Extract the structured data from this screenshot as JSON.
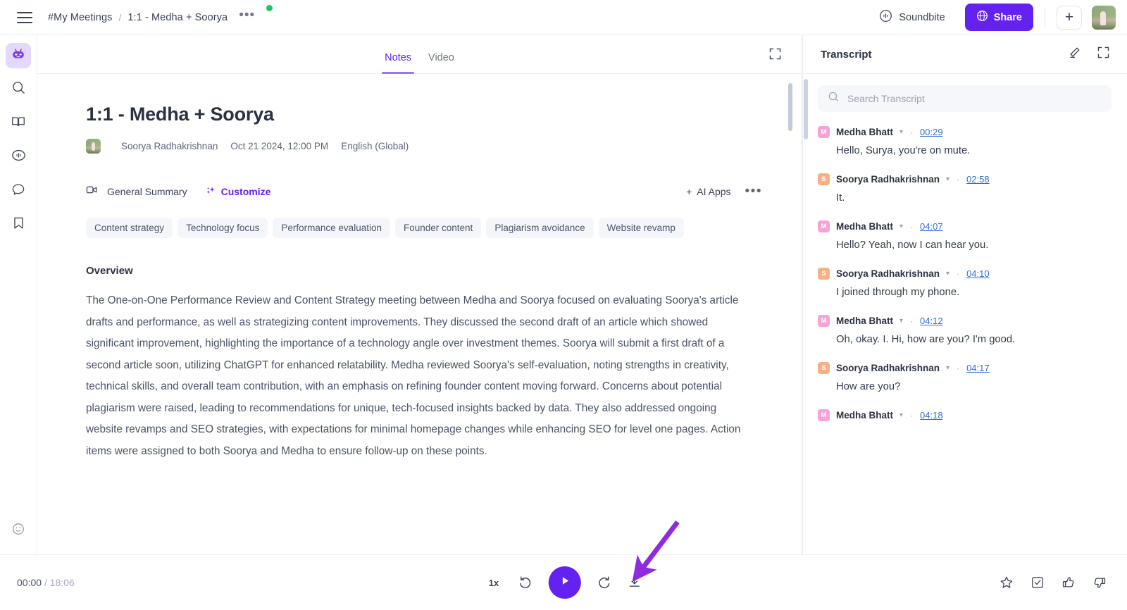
{
  "topbar": {
    "menu_icon": "hamburger-icon",
    "breadcrumb_root": "#My Meetings",
    "breadcrumb_sep": "/",
    "breadcrumb_current": "1:1 - Medha + Soorya",
    "breadcrumb_more": "•••",
    "status_dot_color": "#22c55e",
    "soundbite_label": "Soundbite",
    "share_label": "Share",
    "add_label": "+",
    "accent_color": "#6322f0"
  },
  "rail": {
    "items": [
      {
        "name": "assistant-bot-icon",
        "active": true
      },
      {
        "name": "search-icon",
        "active": false
      },
      {
        "name": "book-icon",
        "active": false
      },
      {
        "name": "soundbite-icon",
        "active": false
      },
      {
        "name": "chat-bubble-icon",
        "active": false
      },
      {
        "name": "bookmark-icon",
        "active": false
      }
    ],
    "bottom_item": {
      "name": "smiley-icon"
    }
  },
  "notes": {
    "tabs": [
      {
        "label": "Notes",
        "active": true
      },
      {
        "label": "Video",
        "active": false
      }
    ],
    "expand_icon": "expand-icon",
    "title": "1:1 - Medha + Soorya",
    "meta": {
      "owner": "Soorya Radhakrishnan",
      "datetime": "Oct 21 2024, 12:00 PM",
      "language": "English (Global)"
    },
    "summary_type": "General Summary",
    "customize_label": "Customize",
    "ai_apps_label": "AI Apps",
    "ai_apps_plus": "+",
    "more_label": "•••",
    "chips": [
      "Content strategy",
      "Technology focus",
      "Performance evaluation",
      "Founder content",
      "Plagiarism avoidance",
      "Website revamp"
    ],
    "section_heading": "Overview",
    "section_body": "The One-on-One Performance Review and Content Strategy meeting between Medha and Soorya focused on evaluating Soorya's article drafts and performance, as well as strategizing content improvements. They discussed the second draft of an article which showed significant improvement, highlighting the importance of a technology angle over investment themes. Soorya will submit a first draft of a second article soon, utilizing ChatGPT for enhanced relatability. Medha reviewed Soorya's self-evaluation, noting strengths in creativity, technical skills, and overall team contribution, with an emphasis on refining founder content moving forward. Concerns about potential plagiarism were raised, leading to recommendations for unique, tech-focused insights backed by data. They also addressed ongoing website revamps and SEO strategies, with expectations for minimal homepage changes while enhancing SEO for level one pages. Action items were assigned to both Soorya and Medha to ensure follow-up on these points."
  },
  "transcript": {
    "title": "Transcript",
    "edit_icon": "pencil-icon",
    "expand_icon": "expand-icon",
    "search_placeholder": "Search Transcript",
    "entries": [
      {
        "initial": "M",
        "speaker": "Medha Bhatt",
        "time": "00:29",
        "text": "Hello, Surya, you're on mute.",
        "color": "#f6a3d8"
      },
      {
        "initial": "S",
        "speaker": "Soorya Radhakrishnan",
        "time": "02:58",
        "text": "It.",
        "color": "#f5b183"
      },
      {
        "initial": "M",
        "speaker": "Medha Bhatt",
        "time": "04:07",
        "text": "Hello? Yeah, now I can hear you.",
        "color": "#f6a3d8"
      },
      {
        "initial": "S",
        "speaker": "Soorya Radhakrishnan",
        "time": "04:10",
        "text": "I joined through my phone.",
        "color": "#f5b183"
      },
      {
        "initial": "M",
        "speaker": "Medha Bhatt",
        "time": "04:12",
        "text": "Oh, okay. I. Hi, how are you? I'm good.",
        "color": "#f6a3d8"
      },
      {
        "initial": "S",
        "speaker": "Soorya Radhakrishnan",
        "time": "04:17",
        "text": "How are you?",
        "color": "#f5b183"
      },
      {
        "initial": "M",
        "speaker": "Medha Bhatt",
        "time": "04:18",
        "text": "",
        "color": "#f6a3d8"
      }
    ]
  },
  "player": {
    "current_time": "00:00",
    "separator": "/",
    "duration": "18:06",
    "speed": "1x",
    "rewind_icon": "rewind-icon",
    "play_icon": "play-icon",
    "forward_icon": "forward-icon",
    "download_icon": "download-icon",
    "right_icons": [
      "star-icon",
      "checkbox-icon",
      "thumbs-up-icon",
      "thumbs-down-icon"
    ]
  },
  "annotation": {
    "arrow_color": "#8f2ae0"
  }
}
